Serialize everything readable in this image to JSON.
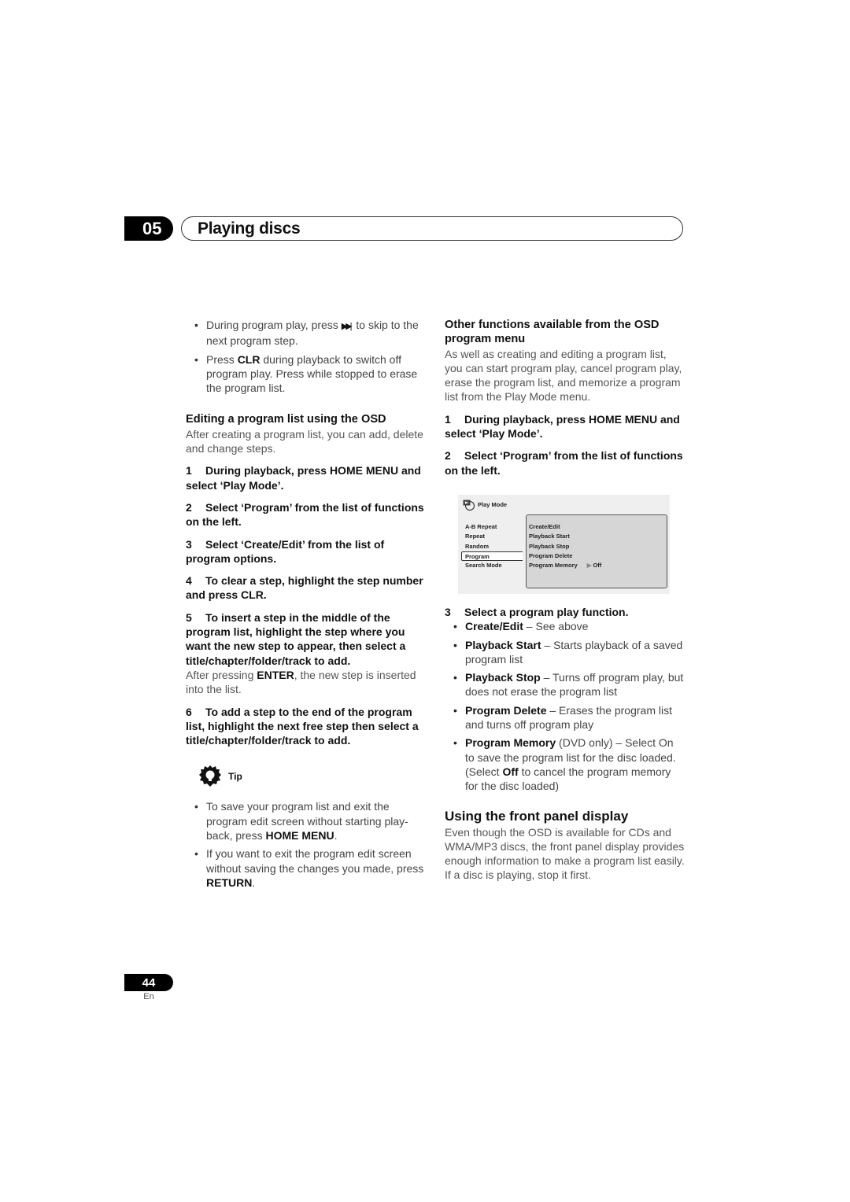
{
  "chapter": {
    "number": "05",
    "title": "Playing discs"
  },
  "left": {
    "bullets_top": [
      {
        "pre": "During program play, press ",
        "icon": "▶▶|",
        "post": " to skip to the next program step."
      },
      {
        "pre": "Press ",
        "bold": "CLR",
        "post": " during playback to switch off program play. Press while stopped to erase the program list."
      }
    ],
    "section_heading": "Editing a program list using the OSD",
    "section_intro": "After creating a program list, you can add, delete and change steps.",
    "steps": [
      {
        "n": "1",
        "text": "During playback, press HOME MENU and select ‘Play Mode’."
      },
      {
        "n": "2",
        "text": "Select ‘Program’ from the list of functions on the left."
      },
      {
        "n": "3",
        "text": "Select ‘Create/Edit’ from the list of program options."
      },
      {
        "n": "4",
        "text": "To clear a step, highlight the step number and press CLR."
      },
      {
        "n": "5",
        "text": "To insert a step in the middle of the program list, highlight the step where you want the new step to appear, then select a title/chapter/folder/track to add."
      },
      {
        "n": "6",
        "text": "To add a step to the end of the program list, highlight the next free step then select a title/chapter/folder/track to add."
      }
    ],
    "step5_note": {
      "pre": "After pressing ",
      "bold": "ENTER",
      "post": ", the new step is inserted into the list."
    },
    "tip": {
      "label": "Tip",
      "bullets": [
        {
          "pre": "To save your program list and exit the program edit screen without starting play-back, press ",
          "bold": "HOME MENU",
          "post": "."
        },
        {
          "pre": "If you want to exit the program edit screen without saving the changes you made, press ",
          "bold": "RETURN",
          "post": "."
        }
      ]
    }
  },
  "right": {
    "section_heading": "Other functions available from the OSD program menu",
    "section_intro": "As well as creating and editing a program list, you can start program play, cancel program play, erase the program list, and memorize a program list from the Play Mode menu.",
    "steps": [
      {
        "n": "1",
        "text": "During playback, press HOME MENU and select ‘Play Mode’."
      },
      {
        "n": "2",
        "text": "Select ‘Program’ from the list of functions on the left."
      },
      {
        "n": "3",
        "text": "Select a program play function."
      }
    ],
    "osd": {
      "title": "Play Mode",
      "left_items": [
        "A-B Repeat",
        "Repeat",
        "Random",
        "Program",
        "Search Mode"
      ],
      "selected_left": "Program",
      "right_items": [
        "Create/Edit",
        "Playback Start",
        "Playback Stop",
        "Program Delete",
        "Program Memory"
      ],
      "memory_value": "Off"
    },
    "functions": [
      {
        "name": "Create/Edit",
        "desc": " – See above"
      },
      {
        "name": "Playback Start",
        "desc": " – Starts playback of a saved program list"
      },
      {
        "name": "Playback Stop",
        "desc": " – Turns off program play, but does not erase the program list"
      },
      {
        "name": "Program Delete",
        "desc": " – Erases the program list and turns off program play"
      },
      {
        "name": "Program Memory",
        "desc_pre": " (DVD only) – Select On to save the program list for the disc loaded. (Select ",
        "desc_bold": "Off",
        "desc_post": " to cancel the program memory for the disc loaded)"
      }
    ],
    "front_panel": {
      "heading": "Using the front panel display",
      "text": "Even though the OSD is available for CDs and WMA/MP3 discs, the front panel display provides enough information to make a program list easily. If a disc is playing, stop it first."
    }
  },
  "footer": {
    "page_number": "44",
    "language": "En"
  }
}
